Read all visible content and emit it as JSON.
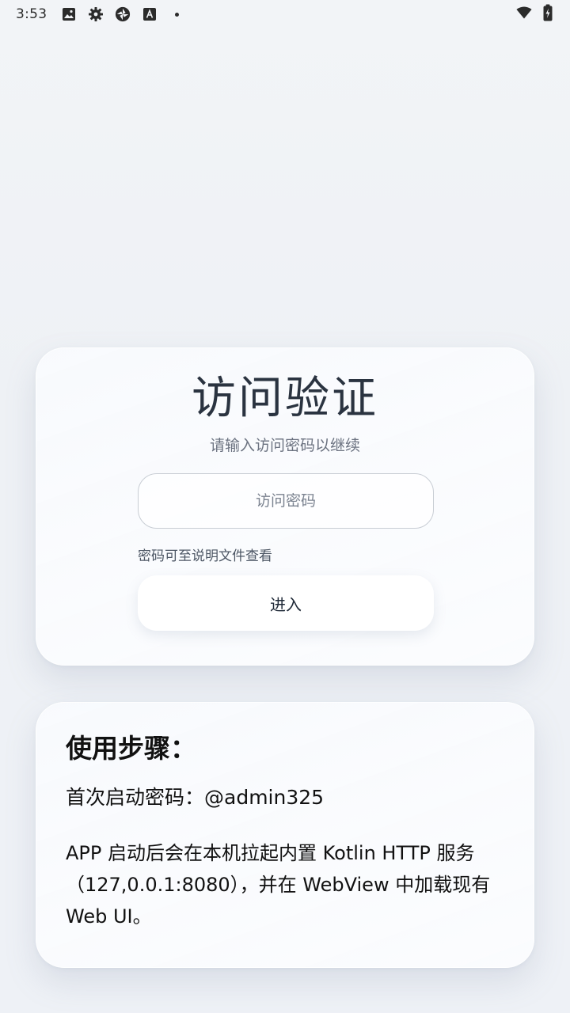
{
  "status_bar": {
    "time": "3:53",
    "left_icons": [
      "image-icon",
      "settings-gear-icon",
      "app-logo-icon",
      "a-badge-icon",
      "notification-dot-icon"
    ],
    "right_icons": [
      "wifi-icon",
      "battery-charging-icon"
    ]
  },
  "login": {
    "title": "访问验证",
    "subtitle": "请输入访问密码以继续",
    "password_placeholder": "访问密码",
    "password_value": "",
    "hint": "密码可至说明文件查看",
    "enter_label": "进入"
  },
  "steps": {
    "heading": "使用步骤：",
    "first_password": "首次启动密码：@admin325",
    "description": "APP 启动后会在本机拉起内置 Kotlin HTTP 服务（127,0.0.1:8080），并在 WebView 中加载现有 Web UI。"
  }
}
